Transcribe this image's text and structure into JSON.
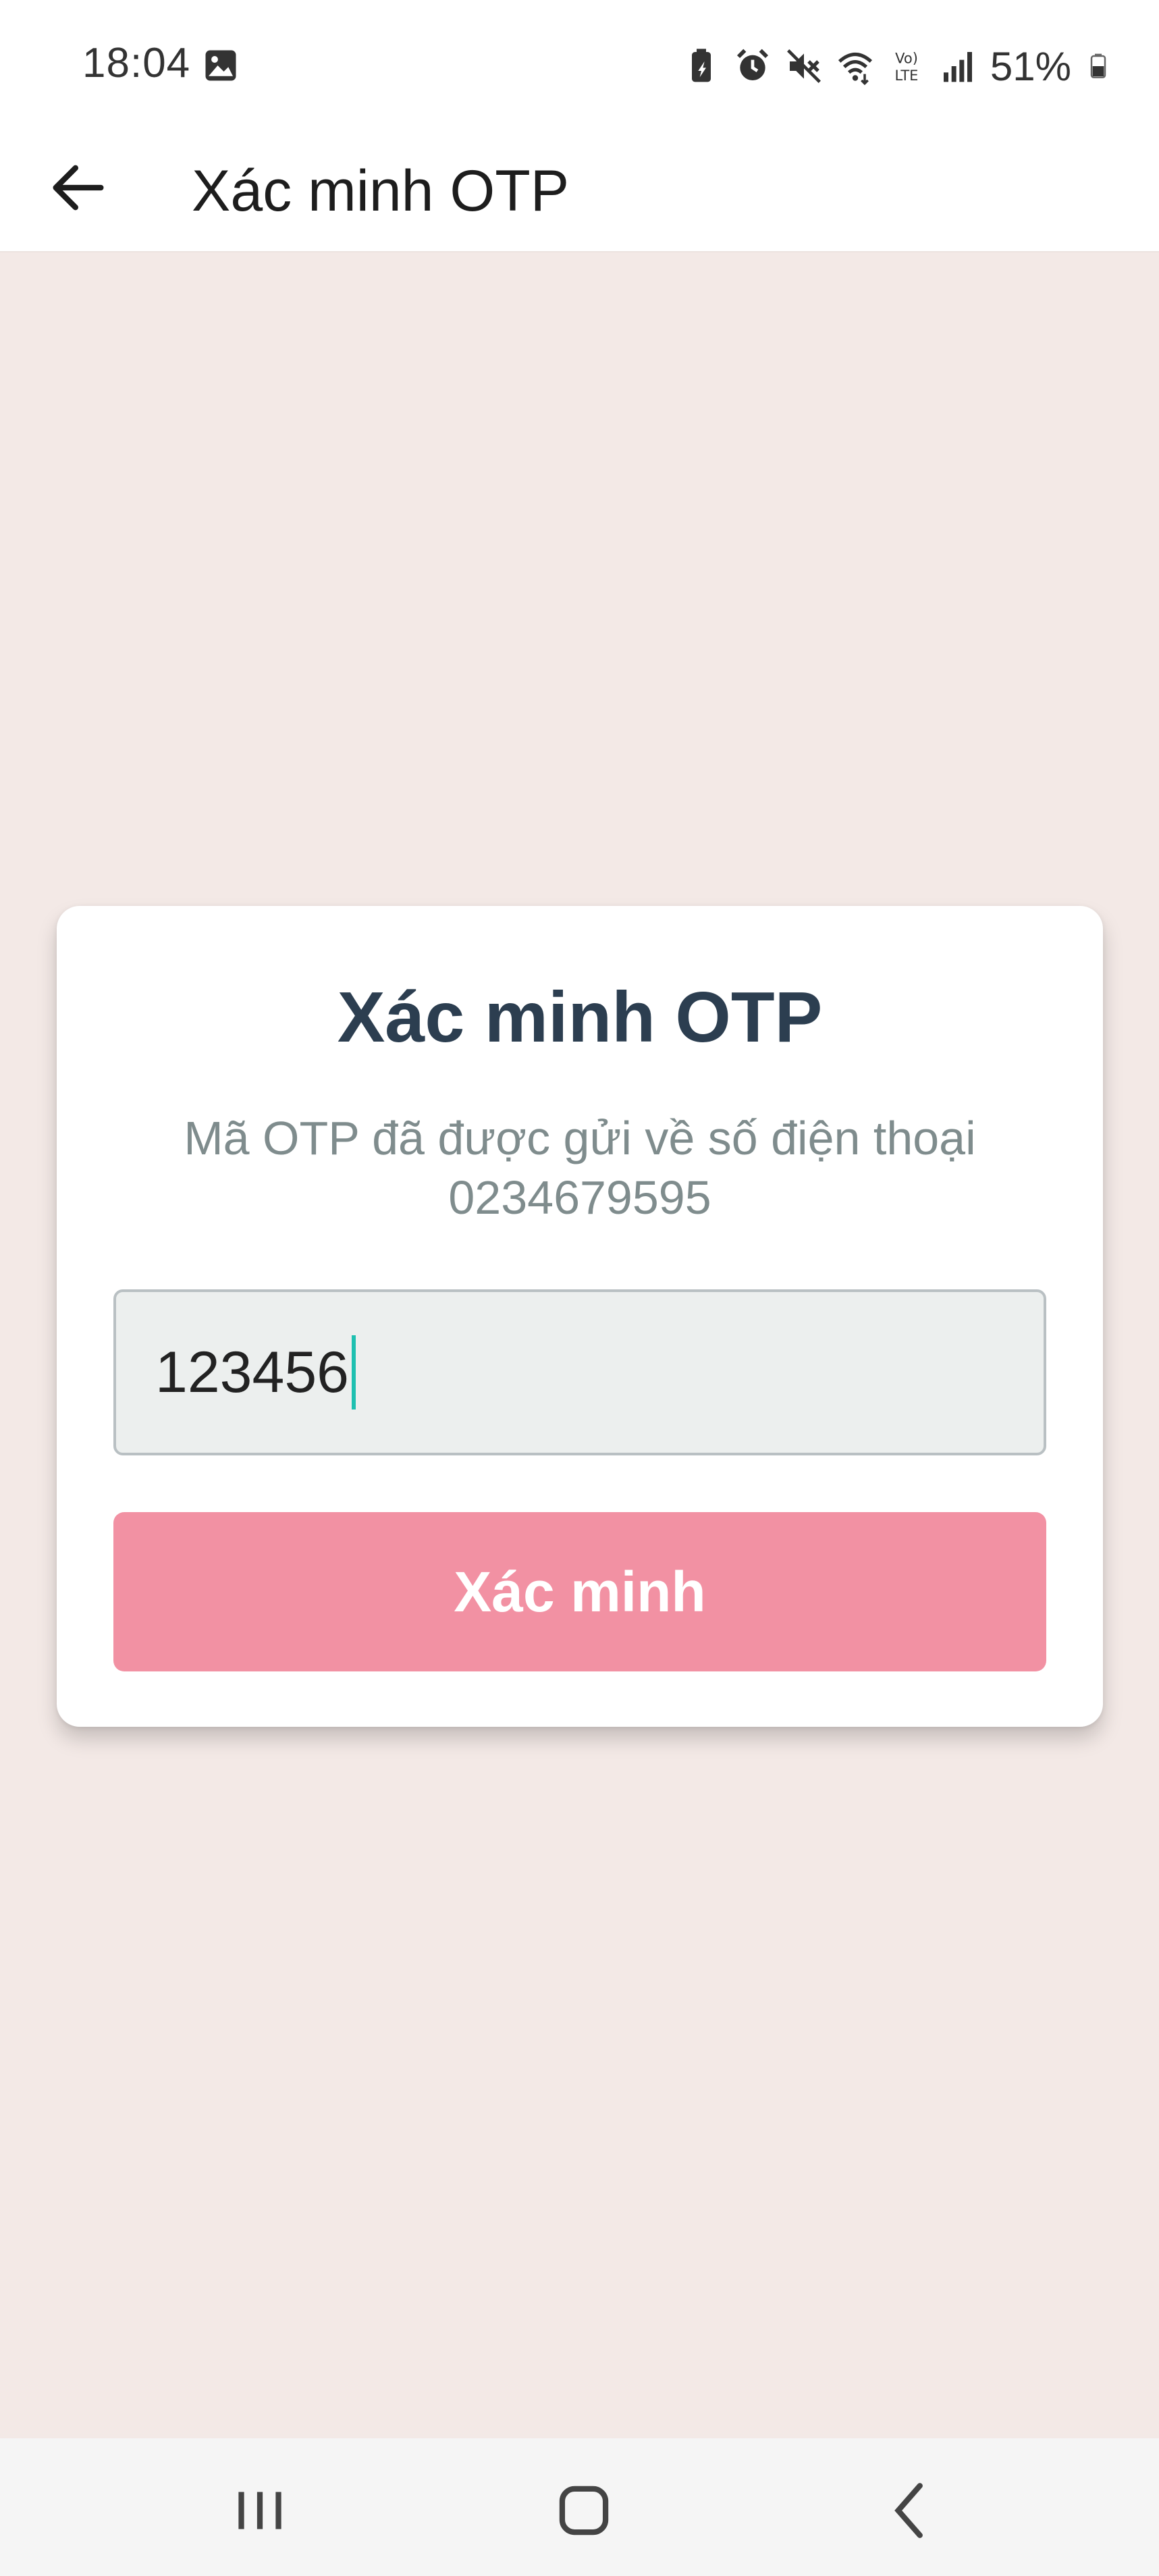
{
  "status_bar": {
    "time": "18:04",
    "battery_text": "51%",
    "icons": [
      "gallery-icon",
      "battery-saver-icon",
      "alarm-icon",
      "mute-icon",
      "wifi-icon",
      "volte-icon",
      "signal-icon",
      "battery-icon"
    ]
  },
  "app_bar": {
    "title": "Xác minh OTP",
    "back_icon": "arrow-left-icon"
  },
  "card": {
    "title": "Xác minh OTP",
    "description": "Mã OTP đã được gửi về số điện thoại 0234679595",
    "otp_value": "123456",
    "verify_label": "Xác minh"
  },
  "nav_bar": {
    "buttons": [
      "recents",
      "home",
      "back"
    ]
  },
  "colors": {
    "background": "#f3e9e6",
    "button": "#f291a3",
    "title": "#2c3e50",
    "description": "#7f8c8d",
    "caret": "#1ec0b0"
  }
}
